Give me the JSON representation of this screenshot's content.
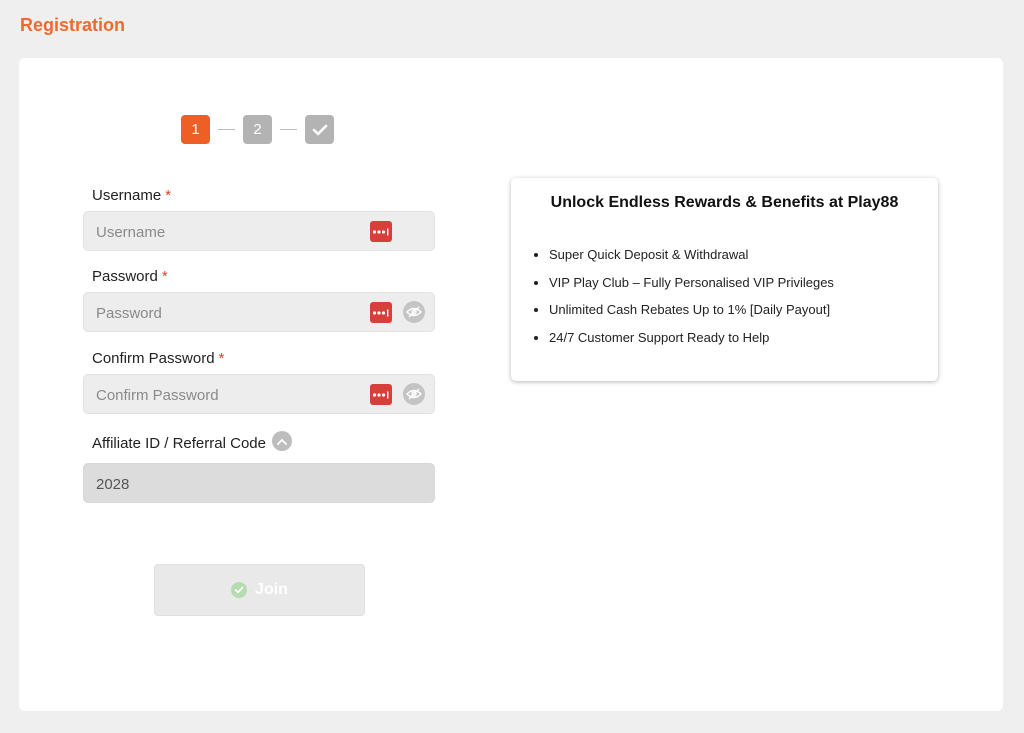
{
  "page": {
    "title": "Registration"
  },
  "stepper": {
    "steps": [
      {
        "label": "1",
        "state": "active"
      },
      {
        "label": "2",
        "state": "inactive"
      },
      {
        "label": "",
        "icon": "check-icon",
        "state": "inactive"
      }
    ]
  },
  "form": {
    "username": {
      "label": "Username",
      "required_mark": "*",
      "placeholder": "Username",
      "value": ""
    },
    "password": {
      "label": "Password",
      "required_mark": "*",
      "placeholder": "Password",
      "value": ""
    },
    "confirm_password": {
      "label": "Confirm Password",
      "required_mark": "*",
      "placeholder": "Confirm Password",
      "value": ""
    },
    "affiliate": {
      "label": "Affiliate ID / Referral Code",
      "value": "2028"
    },
    "join_label": "Join"
  },
  "promo": {
    "title": "Unlock Endless Rewards & Benefits at Play88",
    "benefits": [
      "Super Quick Deposit & Withdrawal",
      "VIP Play Club – Fully Personalised VIP Privileges",
      "Unlimited Cash Rebates Up to 1% [Daily Payout]",
      "24/7 Customer Support Ready to Help"
    ]
  },
  "colors": {
    "accent": "#ee5f26",
    "title": "#ee6a2e",
    "required": "#e0402a",
    "password_manager_icon": "#d5403a"
  },
  "icons": {
    "password_manager": "password-manager-icon",
    "visibility_toggle": "eye-off-icon",
    "collapse": "chevron-up-icon",
    "join": "check-circle-icon"
  }
}
